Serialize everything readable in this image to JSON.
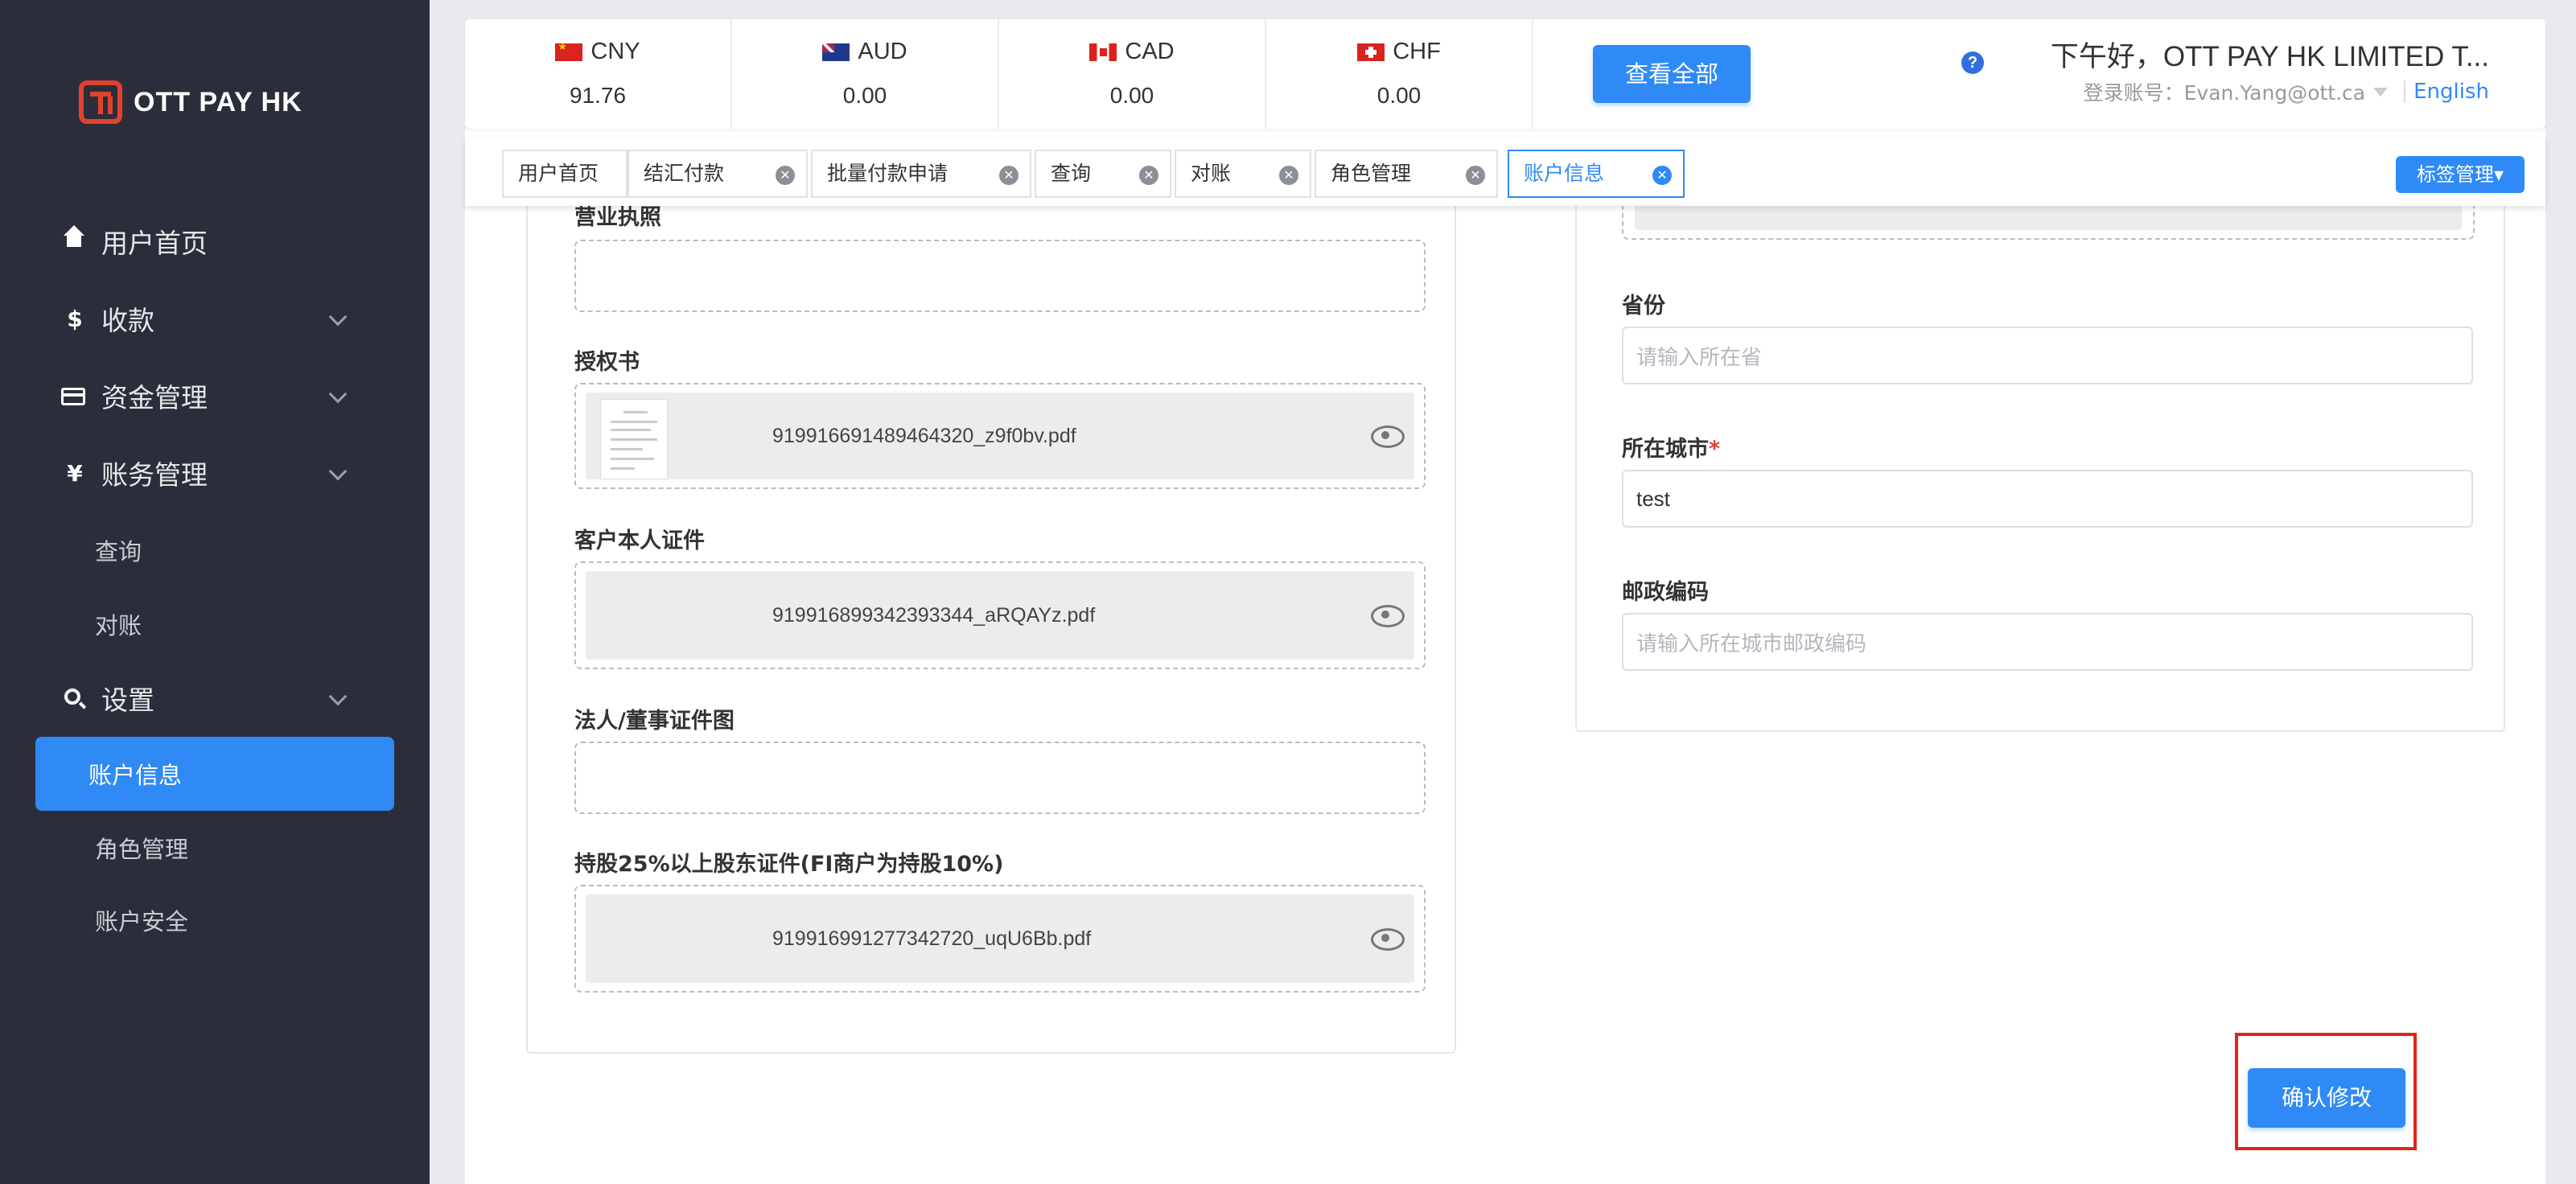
{
  "brand": {
    "logo_text": "OTT PAY HK"
  },
  "sidebar": {
    "items": [
      {
        "label": "用户首页",
        "icon": "home-icon"
      },
      {
        "label": "收款",
        "icon": "dollar-icon"
      },
      {
        "label": "资金管理",
        "icon": "card-icon"
      },
      {
        "label": "账务管理",
        "icon": "yen-icon"
      },
      {
        "label": "设置",
        "icon": "search-icon"
      }
    ],
    "sub_items": {
      "finance": [
        "查询",
        "对账"
      ],
      "settings": [
        "账户信息",
        "角色管理",
        "账户安全"
      ]
    },
    "active": "账户信息"
  },
  "currencies": [
    {
      "code": "CNY",
      "value": "91.76"
    },
    {
      "code": "AUD",
      "value": "0.00"
    },
    {
      "code": "CAD",
      "value": "0.00"
    },
    {
      "code": "CHF",
      "value": "0.00"
    }
  ],
  "header": {
    "view_all": "查看全部",
    "greeting": "下午好，OTT PAY HK LIMITED T...",
    "account_label": "登录账号：Evan.Yang@ott.ca",
    "language": "English"
  },
  "tabs": [
    {
      "label": "用户首页",
      "closable": false
    },
    {
      "label": "结汇付款",
      "closable": true
    },
    {
      "label": "批量付款申请",
      "closable": true
    },
    {
      "label": "查询",
      "closable": true
    },
    {
      "label": "对账",
      "closable": true
    },
    {
      "label": "角色管理",
      "closable": true
    },
    {
      "label": "账户信息",
      "closable": true,
      "active": true
    }
  ],
  "tab_manager": "标签管理▾",
  "form_left": {
    "business_license": {
      "label": "营业执照"
    },
    "authorization": {
      "label": "授权书",
      "file": "919916691489464320_z9f0bv.pdf"
    },
    "customer_id": {
      "label": "客户本人证件",
      "file": "919916899342393344_aRQAYz.pdf"
    },
    "legal_person_id": {
      "label": "法人/董事证件图"
    },
    "shareholder_id": {
      "label": "持股25%以上股东证件(FI商户为持股10%)",
      "file": "919916991277342720_uqU6Bb.pdf"
    }
  },
  "form_right": {
    "province": {
      "label": "省份",
      "placeholder": "请输入所在省"
    },
    "city": {
      "label": "所在城市",
      "required_mark": "*",
      "value": "test"
    },
    "postal": {
      "label": "邮政编码",
      "placeholder": "请输入所在城市邮政编码"
    }
  },
  "actions": {
    "confirm": "确认修改"
  },
  "colors": {
    "primary": "#2f8af5",
    "sidebar_bg": "#2b2e3a",
    "highlight": "#e0241b",
    "brand_red": "#e2412e"
  }
}
